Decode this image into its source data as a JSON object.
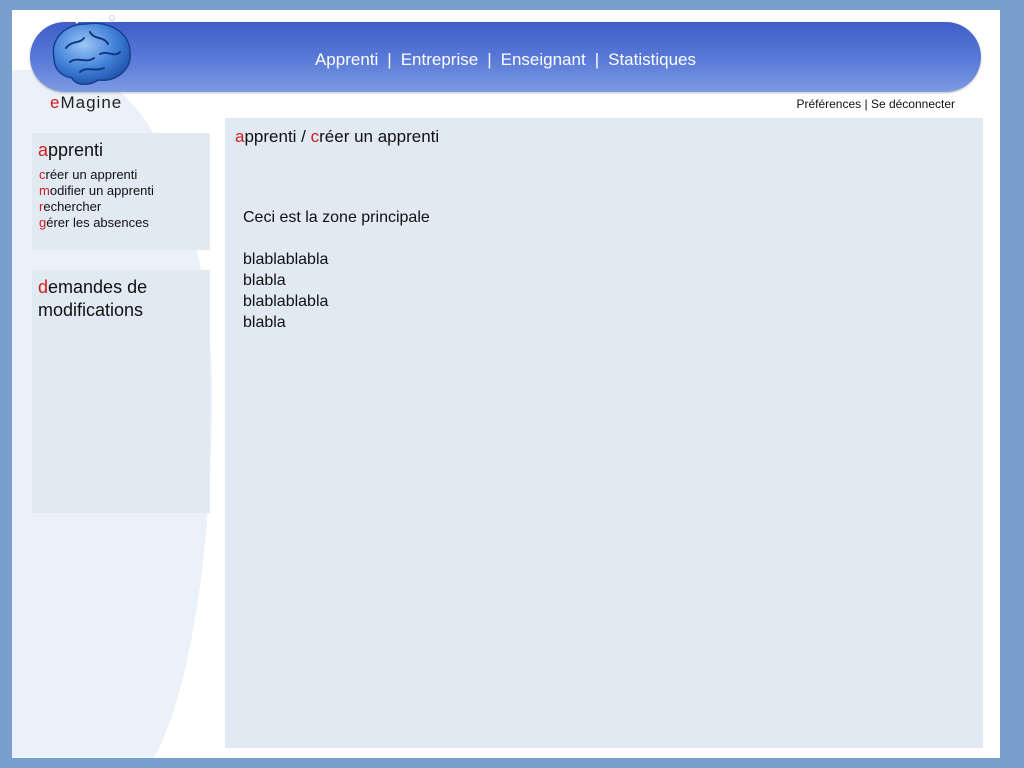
{
  "nav": {
    "items": [
      "Apprenti",
      "Entreprise",
      "Enseignant",
      "Statistiques"
    ],
    "separator": "|"
  },
  "brand": {
    "prefix": "e",
    "rest": "Magine"
  },
  "user_links": {
    "preferences": "Préférences",
    "separator": " | ",
    "logout": "Se déconnecter"
  },
  "sidebar": {
    "apprenti": {
      "title_initial": "a",
      "title_rest": "pprenti",
      "items": [
        {
          "initial": "c",
          "rest": "réer un apprenti"
        },
        {
          "initial": "m",
          "rest": "odifier un apprenti"
        },
        {
          "initial": "r",
          "rest": "echercher"
        },
        {
          "initial": "g",
          "rest": "érer les absences"
        }
      ]
    },
    "demandes": {
      "title_initial": "d",
      "title_rest": "emandes de modifications"
    }
  },
  "main": {
    "breadcrumb": {
      "part1_initial": "a",
      "part1_rest": "pprenti",
      "separator": " / ",
      "part2_initial": "c",
      "part2_rest": "réer un apprenti"
    },
    "intro": "Ceci est la zone principale",
    "lines": [
      "blablablabla",
      "blabla",
      "blablablabla",
      "blabla"
    ]
  },
  "colors": {
    "accent": "#d41c1c",
    "header_bar": "#4a6ad0",
    "panel": "#e1e9f3",
    "page_bg": "#7a9fcf"
  },
  "icons": {
    "logo": "brain-logo-icon"
  }
}
